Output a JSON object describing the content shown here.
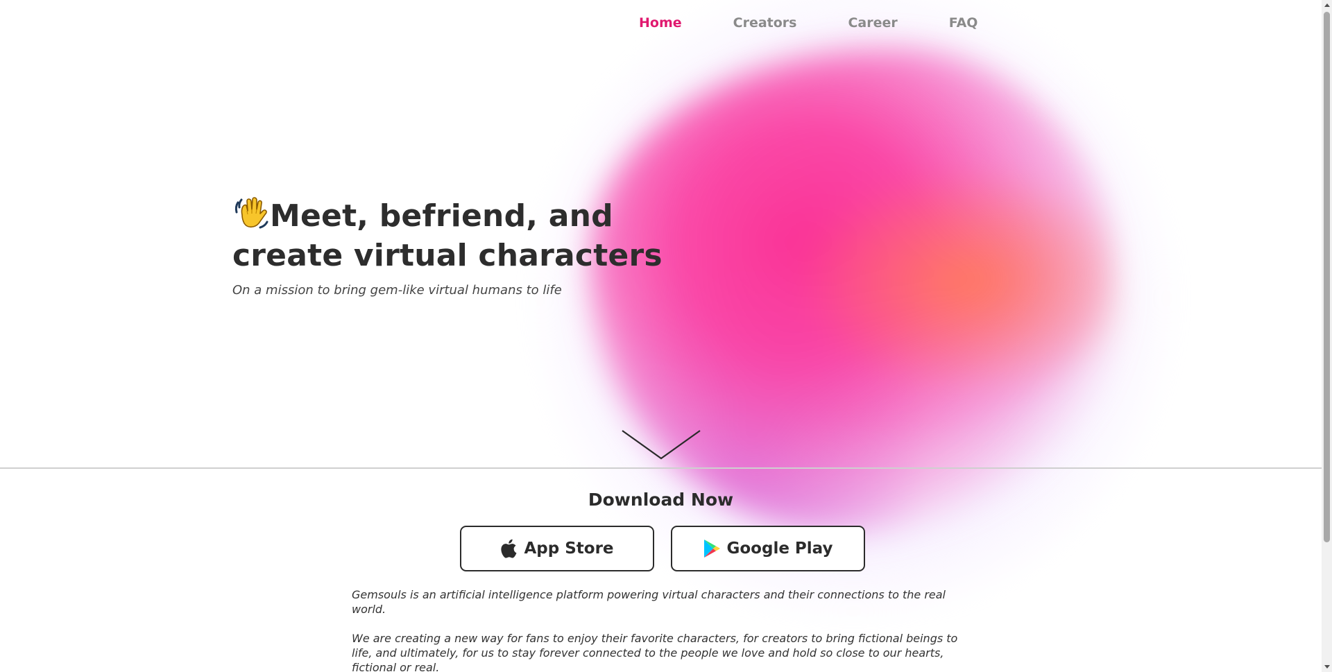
{
  "nav": {
    "items": [
      {
        "label": "Home",
        "active": true
      },
      {
        "label": "Creators",
        "active": false
      },
      {
        "label": "Career",
        "active": false
      },
      {
        "label": "FAQ",
        "active": false
      }
    ]
  },
  "hero": {
    "icon": "waving-hand-icon",
    "title_line1": "Meet, befriend, and",
    "title_line2": "create virtual characters",
    "subtitle": "On a mission to bring gem-like virtual humans to life"
  },
  "download": {
    "title": "Download Now",
    "app_store_label": "App Store",
    "google_play_label": "Google Play",
    "app_store_icon": "apple-icon",
    "google_play_icon": "google-play-icon"
  },
  "about": {
    "paragraph1": "Gemsouls is an artificial intelligence platform powering virtual characters and their connections to the real world.",
    "paragraph2": "We are creating a new way for fans to enjoy their favorite characters, for creators to bring fictional beings to life, and ultimately, for us to stay forever connected to the people we love and hold so close to our hearts, fictional or real."
  },
  "colors": {
    "accent": "#e0196f",
    "nav_inactive": "#8a8a8a",
    "text": "#2b2b2b"
  }
}
